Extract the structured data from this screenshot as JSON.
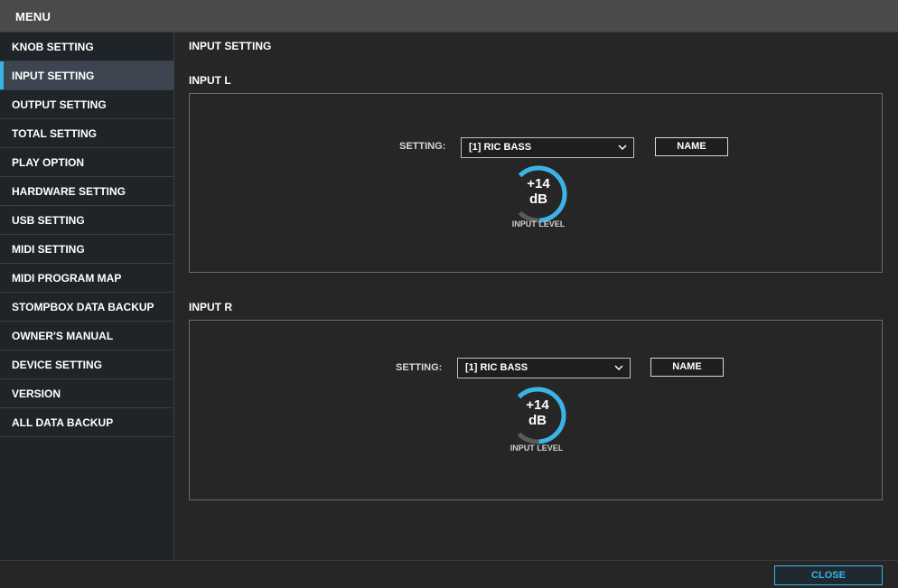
{
  "window": {
    "title": "MENU"
  },
  "sidebar": {
    "items": [
      {
        "label": "KNOB SETTING"
      },
      {
        "label": "INPUT SETTING"
      },
      {
        "label": "OUTPUT SETTING"
      },
      {
        "label": "TOTAL SETTING"
      },
      {
        "label": "PLAY OPTION"
      },
      {
        "label": "HARDWARE SETTING"
      },
      {
        "label": "USB SETTING"
      },
      {
        "label": "MIDI SETTING"
      },
      {
        "label": "MIDI PROGRAM MAP"
      },
      {
        "label": "STOMPBOX DATA BACKUP"
      },
      {
        "label": "OWNER'S MANUAL"
      },
      {
        "label": "DEVICE SETTING"
      },
      {
        "label": "VERSION"
      },
      {
        "label": "ALL DATA BACKUP"
      }
    ],
    "active_item": "INPUT SETTING"
  },
  "main": {
    "page_title": "INPUT SETTING",
    "input_l": {
      "section_label": "INPUT L",
      "setting_label": "SETTING:",
      "setting_value": "[1] RIC BASS",
      "name_button": "NAME",
      "knob_value": "+14",
      "knob_unit": "dB",
      "knob_label": "INPUT LEVEL"
    },
    "input_r": {
      "section_label": "INPUT R",
      "setting_label": "SETTING:",
      "setting_value": "[1] RIC BASS",
      "name_button": "NAME",
      "knob_value": "+14",
      "knob_unit": "dB",
      "knob_label": "INPUT LEVEL"
    }
  },
  "footer": {
    "close_label": "CLOSE"
  },
  "colors": {
    "accent": "#3ab4e8",
    "title_bar": "#4a4a4a",
    "sidebar_bg": "#1f2428",
    "sidebar_active": "#3d4650",
    "main_bg": "#262626",
    "knob_track": "#5a5a5a"
  },
  "icons": {
    "select_arrow": "chevron-down-icon"
  }
}
